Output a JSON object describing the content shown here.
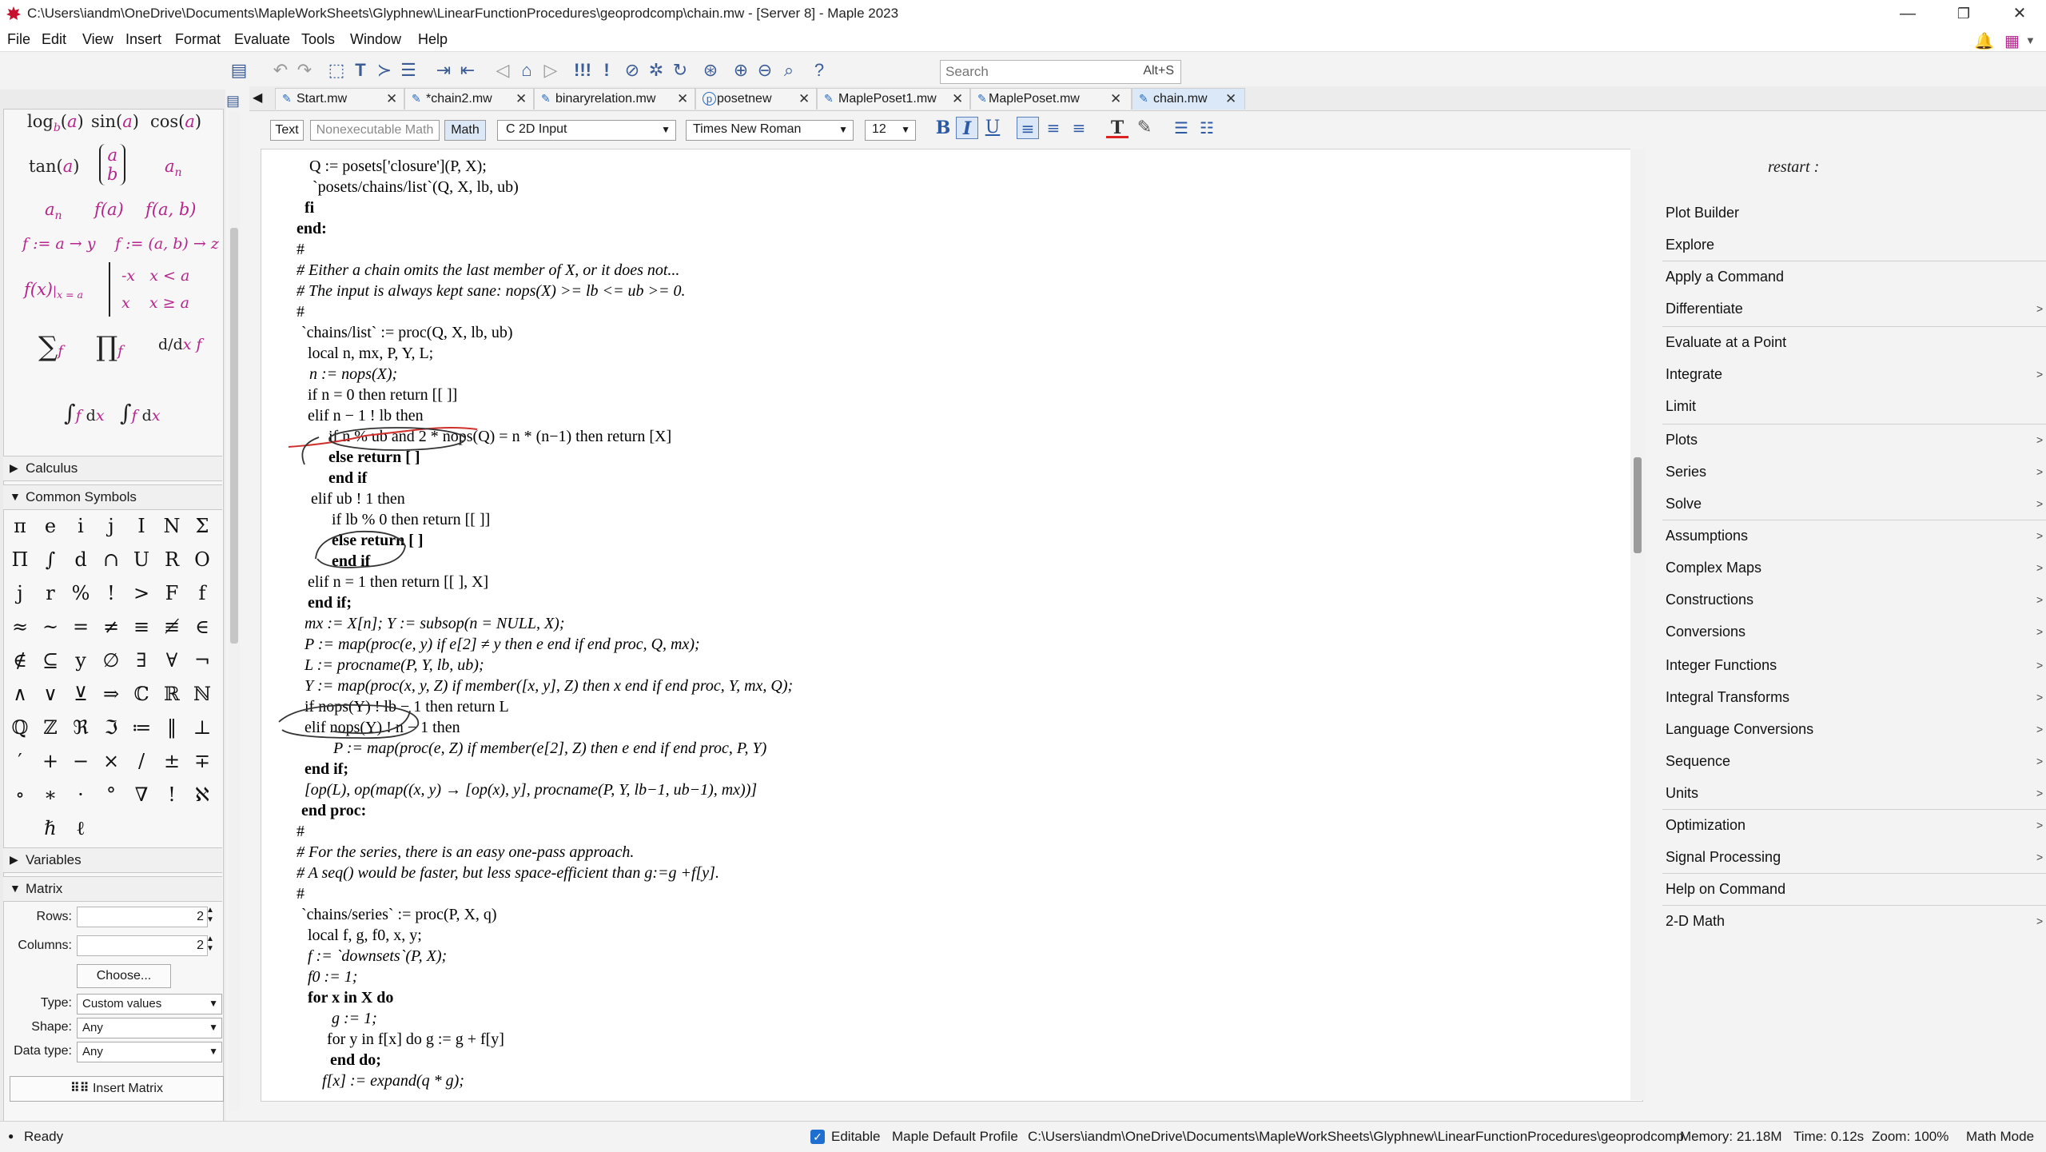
{
  "window": {
    "title": "C:\\Users\\iandm\\OneDrive\\Documents\\MapleWorkSheets\\Glyphnew\\LinearFunctionProcedures\\geoprodcomp\\chain.mw - [Server 8] - Maple 2023",
    "minimize": "—",
    "maximize": "❐",
    "close": "✕"
  },
  "menu": [
    "File",
    "Edit",
    "View",
    "Insert",
    "Format",
    "Evaluate",
    "Tools",
    "Window",
    "Help"
  ],
  "search": {
    "placeholder": "Search",
    "shortcut": "Alt+S"
  },
  "palette": {
    "calculus_label": "Calculus",
    "common_symbols_label": "Common Symbols",
    "variables_label": "Variables",
    "matrix_label": "Matrix",
    "symbols": [
      "π",
      "e",
      "i",
      "j",
      "I",
      "N",
      "Σ",
      "Π",
      "∫",
      "d",
      "∩",
      "U",
      "R",
      "O",
      "j",
      "r",
      "%",
      "!",
      ">",
      "F",
      "f",
      "≈",
      "~",
      "=",
      "≠",
      "≡",
      "≢",
      "∈",
      "∉",
      "⊆",
      "y",
      "∅",
      "∃",
      "∀",
      "¬",
      "∧",
      "∨",
      "⊻",
      "⇒",
      "ℂ",
      "ℝ",
      "ℕ",
      "ℚ",
      "ℤ",
      "ℜ",
      "ℑ",
      "≔",
      "‖",
      "⊥",
      "′",
      "+",
      "−",
      "×",
      "/",
      "±",
      "∓",
      "∘",
      "∗",
      "·",
      "°",
      "∇",
      "!",
      "ℵ",
      "ℏ",
      "ℓ"
    ],
    "matrix": {
      "rows_label": "Rows:",
      "rows_value": "2",
      "cols_label": "Columns:",
      "cols_value": "2",
      "choose_label": "Choose...",
      "type_label": "Type:",
      "type_value": "Custom values",
      "shape_label": "Shape:",
      "shape_value": "Any",
      "datatype_label": "Data type:",
      "datatype_value": "Any",
      "insert_label": "Insert Matrix"
    }
  },
  "tabs": [
    {
      "label": "Start.mw"
    },
    {
      "label": "*chain2.mw"
    },
    {
      "label": "binaryrelation.mw"
    },
    {
      "label": "posetnew"
    },
    {
      "label": "MaplePoset1.mw"
    },
    {
      "label": "MaplePoset.mw"
    },
    {
      "label": "chain.mw"
    }
  ],
  "formatbar": {
    "text": "Text",
    "nonexec": "Nonexecutable Math",
    "math": "Math",
    "input_mode": "2D Input",
    "font": "Times New Roman",
    "size": "12"
  },
  "context_panel": {
    "restart": "restart :",
    "items": [
      {
        "label": "Plot Builder",
        "arrow": ""
      },
      {
        "label": "Explore",
        "arrow": ""
      },
      {
        "label": "Apply a Command",
        "arrow": ""
      },
      {
        "label": "Differentiate",
        "arrow": ">"
      },
      {
        "label": "Evaluate at a Point",
        "arrow": ""
      },
      {
        "label": "Integrate",
        "arrow": ">"
      },
      {
        "label": "Limit",
        "arrow": ""
      },
      {
        "label": "Plots",
        "arrow": ">"
      },
      {
        "label": "Series",
        "arrow": ">"
      },
      {
        "label": "Solve",
        "arrow": ">"
      },
      {
        "label": "Assumptions",
        "arrow": ">"
      },
      {
        "label": "Complex Maps",
        "arrow": ">"
      },
      {
        "label": "Constructions",
        "arrow": ">"
      },
      {
        "label": "Conversions",
        "arrow": ">"
      },
      {
        "label": "Integer Functions",
        "arrow": ">"
      },
      {
        "label": "Integral Transforms",
        "arrow": ">"
      },
      {
        "label": "Language Conversions",
        "arrow": ">"
      },
      {
        "label": "Sequence",
        "arrow": ">"
      },
      {
        "label": "Units",
        "arrow": ">"
      },
      {
        "label": "Optimization",
        "arrow": ">"
      },
      {
        "label": "Signal Processing",
        "arrow": ">"
      },
      {
        "label": "Help on Command",
        "arrow": ""
      },
      {
        "label": "2-D Math",
        "arrow": ">"
      }
    ]
  },
  "status": {
    "ready": "Ready",
    "editable": "Editable",
    "profile": "Maple Default Profile",
    "path": "C:\\Users\\iandm\\OneDrive\\Documents\\MapleWorkSheets\\Glyphnew\\LinearFunctionProcedures\\geoprodcomp",
    "memory": "Memory: 21.18M",
    "time": "Time: 0.12s",
    "zoom": "Zoom: 100%",
    "mode": "Math Mode"
  },
  "code": [
    "Q := posets['closure'](P, X);",
    "`posets/chains/list`(Q, X, lb, ub)",
    "fi",
    "end:",
    "#",
    "# Either a chain omits the last member of X, or it does not...",
    "# The input is always kept sane:  nops(X) >= lb <= ub >= 0.",
    "#",
    "`chains/list` := proc(Q, X, lb, ub)",
    "local n, mx, P, Y, L;",
    "n := nops(X);",
    "if n = 0 then return [[ ]]",
    "elif n − 1 ! lb then",
    "if n % ub and 2 * nops(Q) = n * (n−1) then return [X]",
    "else return [ ]",
    "end if",
    "elif ub ! 1 then",
    "if lb % 0 then return [[ ]]",
    "else return [ ]",
    "end if",
    "elif  n = 1 then return [[ ], X]",
    "end if;",
    "mx := X[n]; Y := subsop(n = NULL, X);",
    "P := map(proc(e, y) if e[2] ≠ y then e end if end proc, Q, mx);",
    "L := procname(P, Y, lb, ub);",
    "Y := map(proc(x, y, Z) if member([x, y], Z) then x end if end proc, Y, mx, Q);",
    "if nops(Y) ! lb − 1 then return L",
    "elif nops(Y) ! n − 1 then",
    "P := map(proc(e, Z) if member(e[2], Z) then e end if end proc, P, Y)",
    "end if;",
    "[op(L), op(map((x, y) → [op(x), y], procname(P, Y, lb−1, ub−1), mx))]",
    "end proc:",
    "#",
    "# For the series, there is an easy one-pass approach.",
    "# A seq() would be faster, but less space-efficient than g:=g +f[y].",
    "#",
    "`chains/series` := proc(P, X, q)",
    "local f, g, f0, x, y;",
    "f := `downsets`(P, X);",
    "f0 := 1;",
    "for x in X do",
    "g := 1;",
    "for y in f[x] do g := g + f[y]",
    "end do;",
    "f[x] := expand(q * g);"
  ]
}
